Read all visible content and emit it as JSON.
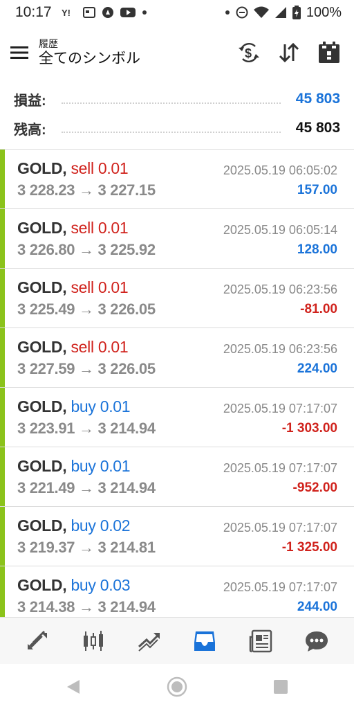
{
  "status_bar": {
    "time": "10:17",
    "notification_icons": [
      "yahoo-icon",
      "news-icon",
      "notification-icon",
      "youtube-icon"
    ],
    "battery": "100%"
  },
  "app_bar": {
    "subtitle": "履歴",
    "title": "全てのシンボル"
  },
  "summary": {
    "profit_label": "損益:",
    "profit_value": "45 803",
    "balance_label": "残高:",
    "balance_value": "45 803"
  },
  "trades": [
    {
      "symbol": "GOLD,",
      "side": "sell",
      "volume": "sell 0.01",
      "prices": "3 228.23 → 3 227.15",
      "time": "2025.05.19 06:05:02",
      "profit": "157.00"
    },
    {
      "symbol": "GOLD,",
      "side": "sell",
      "volume": "sell 0.01",
      "prices": "3 226.80 → 3 225.92",
      "time": "2025.05.19 06:05:14",
      "profit": "128.00"
    },
    {
      "symbol": "GOLD,",
      "side": "sell",
      "volume": "sell 0.01",
      "prices": "3 225.49 → 3 226.05",
      "time": "2025.05.19 06:23:56",
      "profit": "-81.00"
    },
    {
      "symbol": "GOLD,",
      "side": "sell",
      "volume": "sell 0.01",
      "prices": "3 227.59 → 3 226.05",
      "time": "2025.05.19 06:23:56",
      "profit": "224.00"
    },
    {
      "symbol": "GOLD,",
      "side": "buy",
      "volume": "buy 0.01",
      "prices": "3 223.91 → 3 214.94",
      "time": "2025.05.19 07:17:07",
      "profit": "-1 303.00"
    },
    {
      "symbol": "GOLD,",
      "side": "buy",
      "volume": "buy 0.01",
      "prices": "3 221.49 → 3 214.94",
      "time": "2025.05.19 07:17:07",
      "profit": "-952.00"
    },
    {
      "symbol": "GOLD,",
      "side": "buy",
      "volume": "buy 0.02",
      "prices": "3 219.37 → 3 214.81",
      "time": "2025.05.19 07:17:07",
      "profit": "-1 325.00"
    },
    {
      "symbol": "GOLD,",
      "side": "buy",
      "volume": "buy 0.03",
      "prices": "3 214.38 → 3 214.94",
      "time": "2025.05.19 07:17:07",
      "profit": "244.00"
    }
  ],
  "bottom_nav": [
    "quotes-icon",
    "chart-icon",
    "trade-icon",
    "history-icon",
    "news-icon",
    "messages-icon"
  ],
  "active_nav": "history-icon",
  "colors": {
    "profit_positive": "#1a73d9",
    "profit_negative": "#d0221c",
    "sell": "#d0221c",
    "buy": "#1a73d9",
    "row_marker": "#8bc31b",
    "nav_active": "#1a73d9"
  }
}
